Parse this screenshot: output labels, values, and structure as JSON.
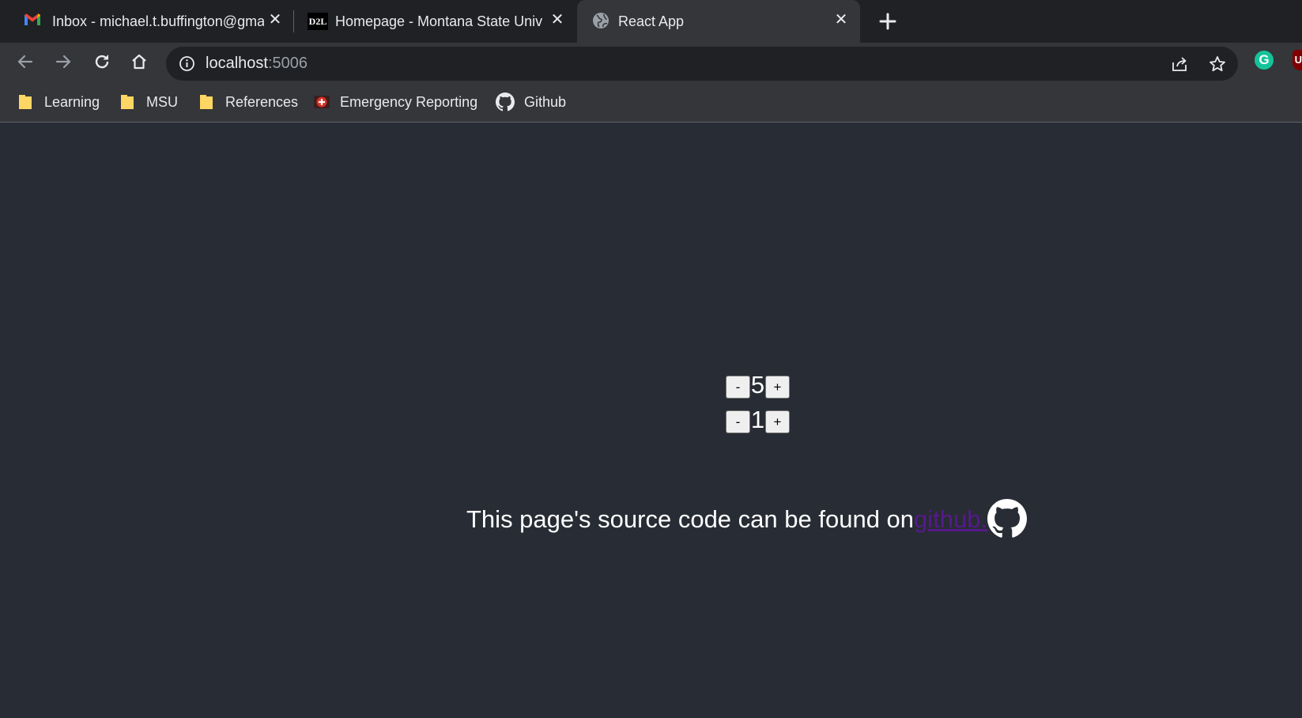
{
  "browser": {
    "tabs": [
      {
        "title": "Inbox - michael.t.buffington@gmail.com",
        "icon": "gmail-icon",
        "active": false
      },
      {
        "title": "Homepage - Montana State University",
        "icon": "d2l-icon",
        "active": false
      },
      {
        "title": "React App",
        "icon": "globe-icon",
        "active": true
      }
    ],
    "d2l_icon_text": "D2L",
    "address": {
      "host": "localhost",
      "port": ":5006"
    },
    "bookmarks": [
      {
        "label": "Learning",
        "icon": "folder-icon"
      },
      {
        "label": "MSU",
        "icon": "folder-icon"
      },
      {
        "label": "References",
        "icon": "folder-icon"
      },
      {
        "label": "Emergency Reporting",
        "icon": "emergency-reporting-icon"
      },
      {
        "label": "Github",
        "icon": "github-icon"
      }
    ],
    "extensions": [
      {
        "name": "grammarly-icon",
        "letter": "G",
        "color": "#15c39a"
      },
      {
        "name": "ublock-icon",
        "letter": "U",
        "color": "#800000"
      }
    ]
  },
  "page": {
    "counters": [
      {
        "decrement_label": "-",
        "value": "5",
        "increment_label": "+"
      },
      {
        "decrement_label": "-",
        "value": "1",
        "increment_label": "+"
      }
    ],
    "footer": {
      "text": "This page's source code can be found on ",
      "link_text": "github."
    }
  },
  "colors": {
    "page_bg": "#282c34",
    "link": "#551a8b",
    "tab_strip": "#202124",
    "toolbar": "#35363a"
  }
}
